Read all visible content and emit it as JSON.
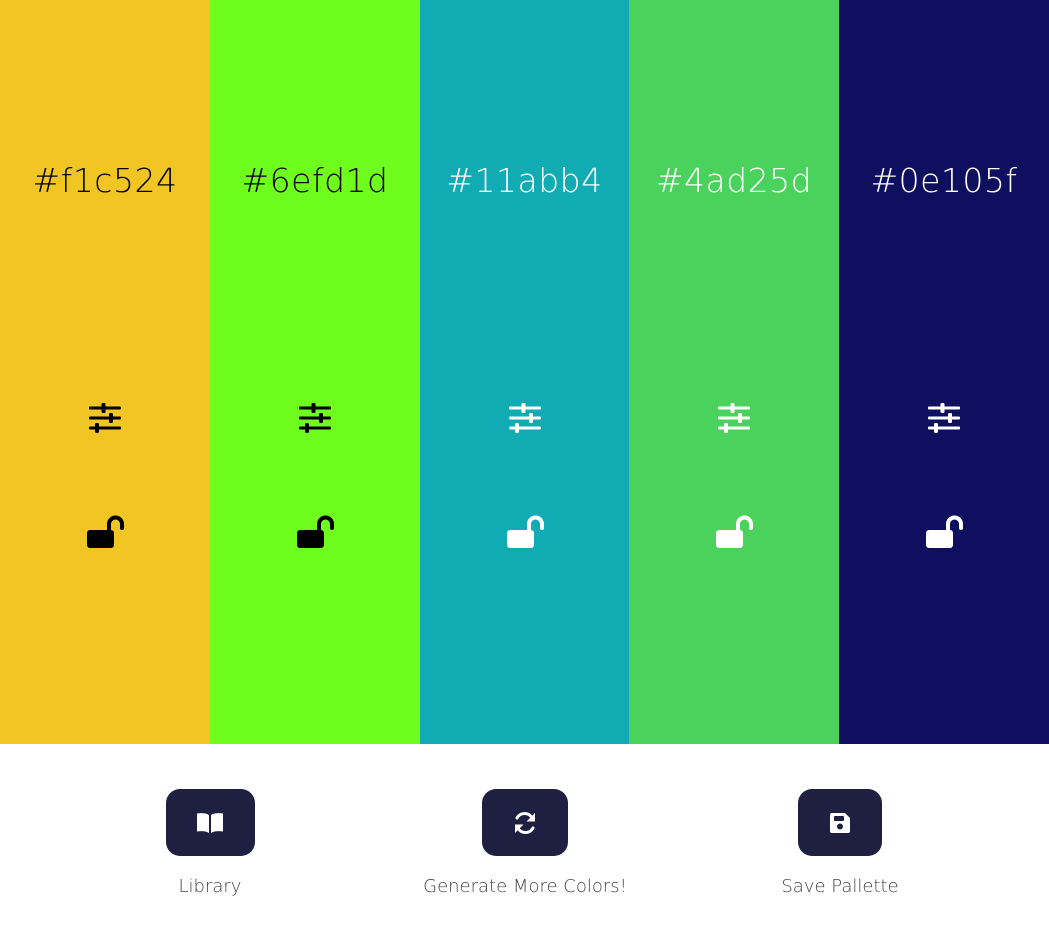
{
  "palette": {
    "swatches": [
      {
        "hex": "#f1c524",
        "background": "#f1c524",
        "text_color": "#000000",
        "adjust_icon": "sliders-icon",
        "lock_icon": "unlocked-padlock-icon"
      },
      {
        "hex": "#6efd1d",
        "background": "#6efd1d",
        "text_color": "#000000",
        "adjust_icon": "sliders-icon",
        "lock_icon": "unlocked-padlock-icon"
      },
      {
        "hex": "#11abb4",
        "background": "#11abb4",
        "text_color": "#ffffff",
        "adjust_icon": "sliders-icon",
        "lock_icon": "unlocked-padlock-icon"
      },
      {
        "hex": "#4ad25d",
        "background": "#4ad25d",
        "text_color": "#ffffff",
        "adjust_icon": "sliders-icon",
        "lock_icon": "unlocked-padlock-icon"
      },
      {
        "hex": "#0e105f",
        "background": "#0e105f",
        "text_color": "#ffffff",
        "adjust_icon": "sliders-icon",
        "lock_icon": "unlocked-padlock-icon"
      }
    ]
  },
  "controls": {
    "button_color": "#1f2041",
    "library": {
      "label": "Library",
      "icon": "book-open-icon"
    },
    "generate": {
      "label": "Generate More Colors!",
      "icon": "refresh-icon"
    },
    "save": {
      "label": "Save Pallette",
      "icon": "floppy-disk-icon"
    }
  }
}
